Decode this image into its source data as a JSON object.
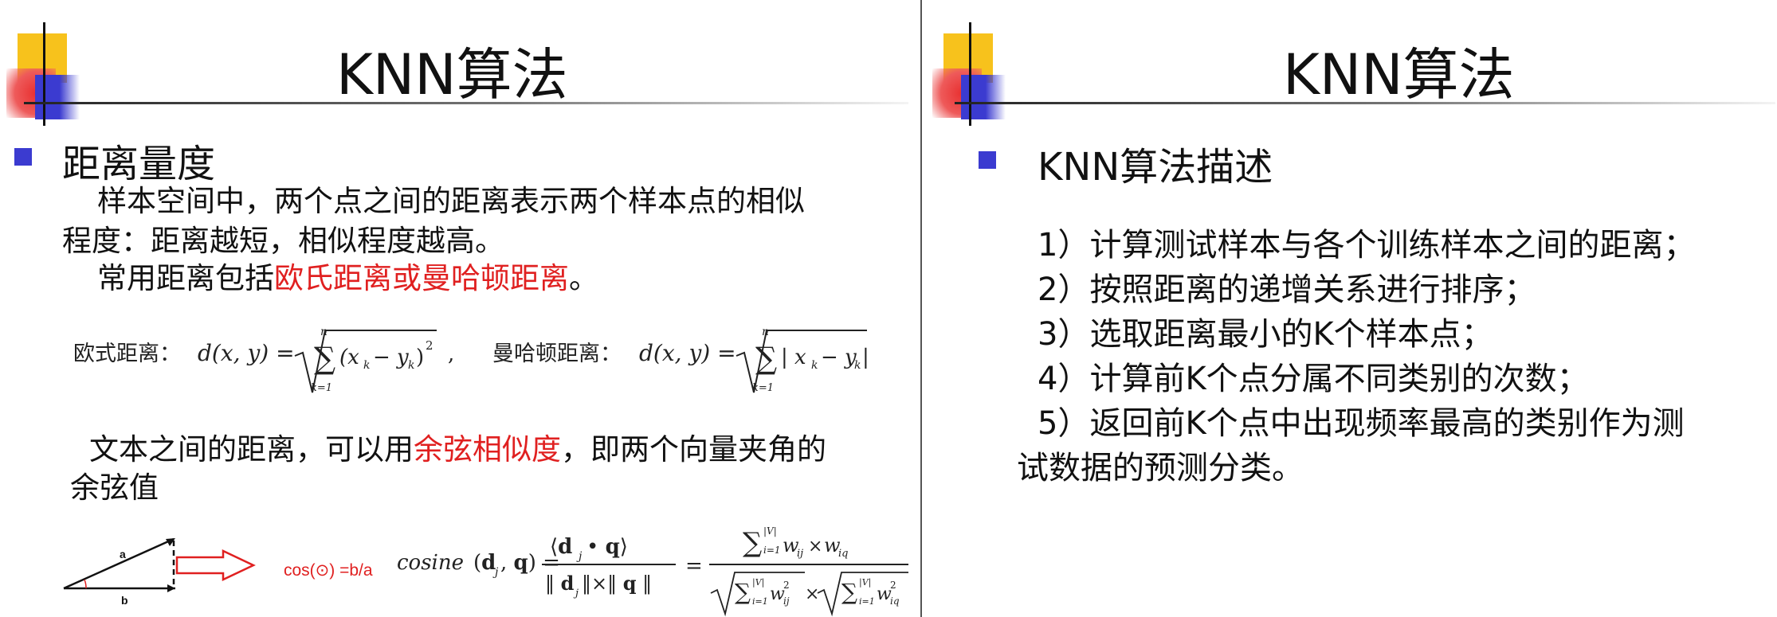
{
  "left_slide": {
    "title": "KNN算法",
    "heading": "距离量度",
    "para1_line1": "样本空间中，两个点之间的距离表示两个样本点的相似",
    "para1_line2": "程度：距离越短，相似程度越高。",
    "para2_prefix": "常用距离包括",
    "para2_red": "欧氏距离或曼哈顿距离",
    "para2_suffix": "。",
    "euclid_label": "欧式距离：",
    "manhattan_label": "曼哈顿距离：",
    "para3_prefix": "文本之间的距离，可以用",
    "para3_red": "余弦相似度",
    "para3_suffix": "，即两个向量夹角的",
    "para3_line2": "余弦值",
    "triangle_a": "a",
    "triangle_b": "b",
    "cos_label": "cos(⊙) =b/a",
    "cosine_text": "cosine"
  },
  "right_slide": {
    "title": "KNN算法",
    "heading": "KNN算法描述",
    "steps": [
      "1）计算测试样本与各个训练样本之间的距离；",
      "2）按照距离的递增关系进行排序；",
      "3）选取距离最小的K个样本点；",
      "4）计算前K个点分属不同类别的次数；",
      "5）返回前K个点中出现频率最高的类别作为测"
    ],
    "step5_line2": "试数据的预测分类。"
  },
  "colors": {
    "accent_blue": "#3b3bd0",
    "highlight_red": "#e02020",
    "logo_yellow": "#f7c21c"
  }
}
